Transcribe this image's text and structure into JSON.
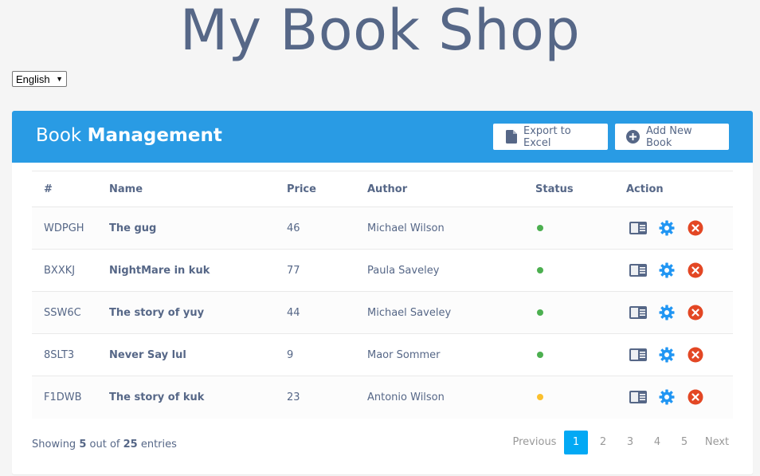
{
  "site_title": "My Book Shop",
  "language": {
    "selected": "English",
    "caret": "▼"
  },
  "panel": {
    "title_light": "Book",
    "title_bold": "Management",
    "export_label": "Export to Excel",
    "add_label": "Add New Book"
  },
  "table": {
    "headers": [
      "#",
      "Name",
      "Price",
      "Author",
      "Status",
      "Action"
    ],
    "rows": [
      {
        "id": "WDPGH",
        "name": "The gug",
        "price": "46",
        "author": "Michael Wilson",
        "status_color": "#4caf50"
      },
      {
        "id": "BXXKJ",
        "name": "NightMare in kuk",
        "price": "77",
        "author": "Paula Saveley",
        "status_color": "#4caf50"
      },
      {
        "id": "SSW6C",
        "name": "The story of yuy",
        "price": "44",
        "author": "Michael Saveley",
        "status_color": "#4caf50"
      },
      {
        "id": "8SLT3",
        "name": "Never Say lul",
        "price": "9",
        "author": "Maor Sommer",
        "status_color": "#4caf50"
      },
      {
        "id": "F1DWB",
        "name": "The story of kuk",
        "price": "23",
        "author": "Antonio Wilson",
        "status_color": "#fbc02d"
      }
    ]
  },
  "footer": {
    "showing_prefix": "Showing",
    "shown_count": "5",
    "out_of_text": "out of",
    "total_count": "25",
    "entries_text": "entries"
  },
  "pagination": {
    "prev_label": "Previous",
    "pages": [
      "1",
      "2",
      "3",
      "4",
      "5"
    ],
    "active_page": "1",
    "next_label": "Next"
  },
  "colors": {
    "header_bg": "#299be4",
    "view_icon": "#566787",
    "settings_icon": "#2196f3",
    "delete_icon": "#e34724",
    "active_page": "#03a9f4"
  },
  "icons": {
    "export": "file-icon",
    "add": "plus-circle-icon",
    "view": "card-view-icon",
    "settings": "gear-icon",
    "delete": "close-circle-icon"
  }
}
